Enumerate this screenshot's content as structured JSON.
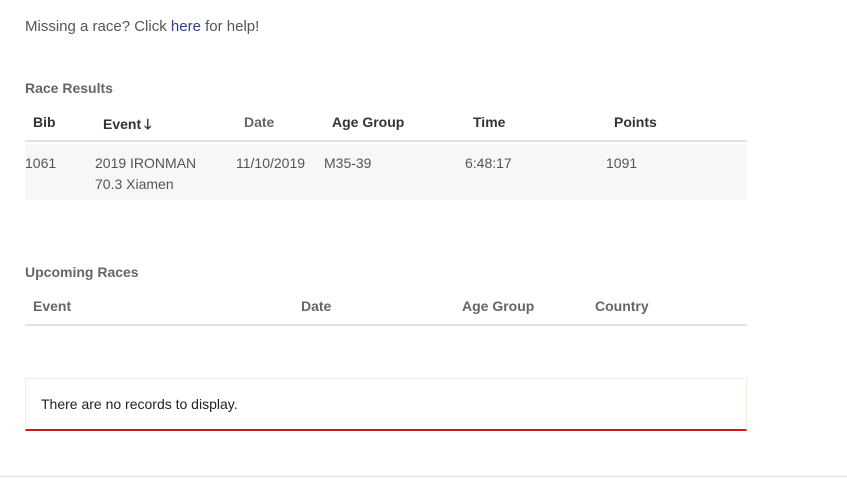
{
  "help": {
    "prefix": "Missing a race? Click ",
    "link": "here",
    "suffix": " for help!"
  },
  "race_results": {
    "title": "Race Results",
    "columns": {
      "bib": "Bib",
      "event": "Event",
      "date": "Date",
      "age_group": "Age Group",
      "time": "Time",
      "points": "Points"
    },
    "sort_icon": "arrow-down-icon",
    "rows": [
      {
        "bib": "1061",
        "event": "2019 IRONMAN 70.3 Xiamen",
        "date": "11/10/2019",
        "age_group": "M35-39",
        "time": "6:48:17",
        "points": "1091"
      }
    ]
  },
  "upcoming_races": {
    "title": "Upcoming Races",
    "columns": {
      "event": "Event",
      "date": "Date",
      "age_group": "Age Group",
      "country": "Country"
    },
    "empty_message": "There are no records to display."
  },
  "colors": {
    "link": "#2c3e8f",
    "accent_border": "#c41e1e"
  }
}
